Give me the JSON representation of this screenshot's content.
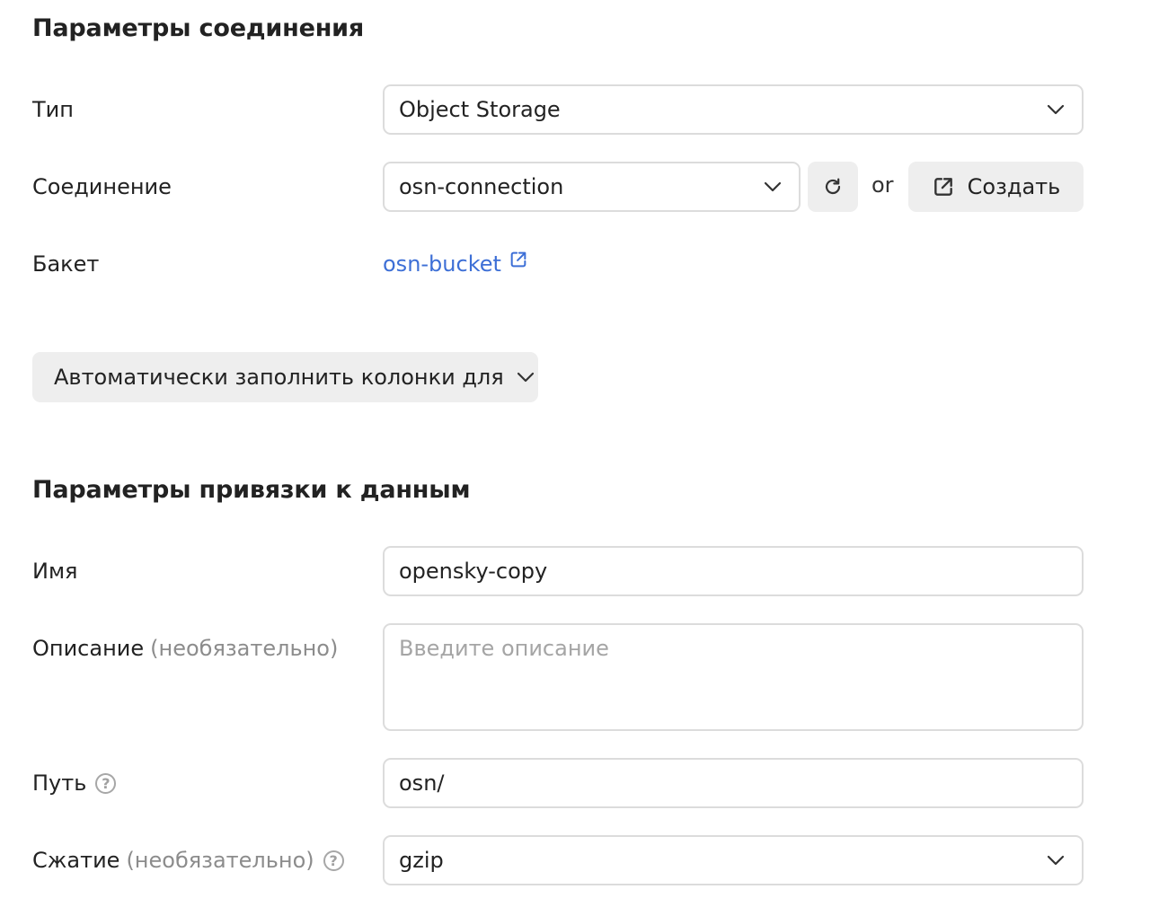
{
  "connection_section": {
    "title": "Параметры соединения",
    "type_label": "Тип",
    "type_value": "Object Storage",
    "connection_label": "Соединение",
    "connection_value": "osn-connection",
    "or_text": "or",
    "create_label": "Создать",
    "bucket_label": "Бакет",
    "bucket_link": "osn-bucket"
  },
  "autofill": {
    "label": "Автоматически заполнить колонки для"
  },
  "binding_section": {
    "title": "Параметры привязки к данным",
    "name_label": "Имя",
    "name_value": "opensky-copy",
    "description_label": "Описание",
    "optional_text": "(необязательно)",
    "description_placeholder": "Введите описание",
    "path_label": "Путь",
    "path_value": "osn/",
    "compression_label": "Сжатие",
    "compression_value": "gzip"
  },
  "icons": {
    "chevron": "chevron-down-icon",
    "refresh": "refresh-icon",
    "external": "external-link-icon",
    "help": "help-icon"
  },
  "colors": {
    "link": "#3d6fd6",
    "border": "#dcdcdc",
    "button_bg": "#eeeeee",
    "muted_text": "#8c8c8c"
  }
}
